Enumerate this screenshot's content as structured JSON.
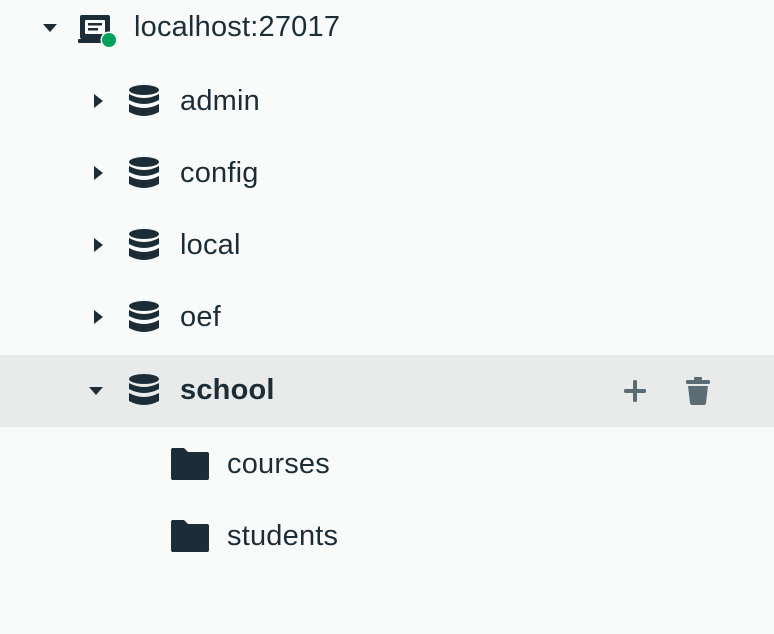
{
  "connection": {
    "name": "localhost:27017",
    "status_color": "#00a35c",
    "expanded": true
  },
  "databases": [
    {
      "name": "admin",
      "expanded": false
    },
    {
      "name": "config",
      "expanded": false
    },
    {
      "name": "local",
      "expanded": false
    },
    {
      "name": "oef",
      "expanded": false
    },
    {
      "name": "school",
      "expanded": true,
      "selected": true
    }
  ],
  "collections": [
    {
      "name": "courses"
    },
    {
      "name": "students"
    }
  ],
  "actions": {
    "create_collection_icon": "plus-icon",
    "drop_database_icon": "trash-icon"
  },
  "colors": {
    "text": "#1c2d38",
    "selected_row": "#e8ebea",
    "action_icon": "#5c6c75",
    "background": "#f9fbfa"
  }
}
